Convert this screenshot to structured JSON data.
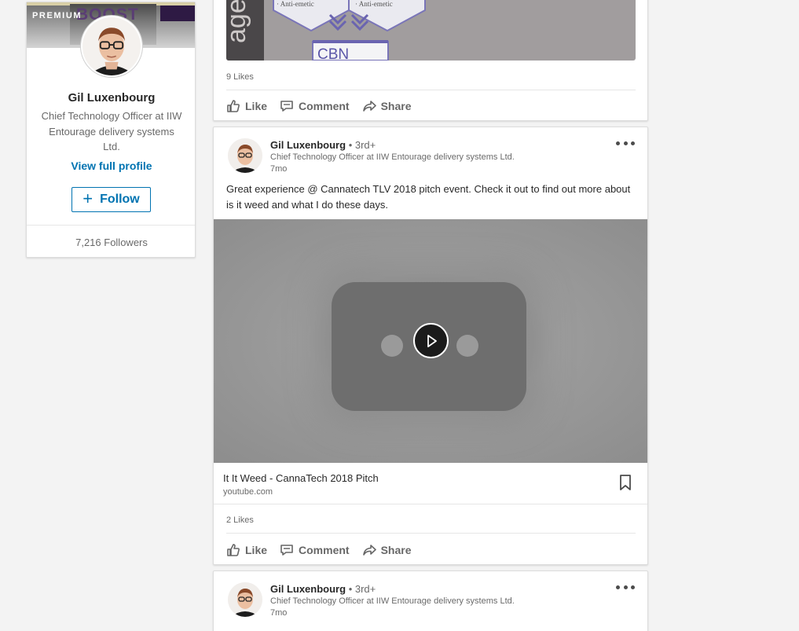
{
  "profile": {
    "badge": "PREMIUM",
    "cover_text": "BOOST",
    "name": "Gil Luxenbourg",
    "headline": "Chief Technology Officer at IIW Entourage delivery systems Ltd.",
    "view_profile_label": "View full profile",
    "follow_label": "Follow",
    "followers": "7,216 Followers"
  },
  "post1": {
    "image_labels": {
      "side_text": "aged",
      "tag_left": "· Anti-emetic",
      "tag_right": "· Anti-emetic",
      "box_label": "CBN"
    },
    "likes": "9 Likes",
    "actions": {
      "like": "Like",
      "comment": "Comment",
      "share": "Share"
    }
  },
  "post2": {
    "author": "Gil Luxenbourg",
    "degree": "• 3rd+",
    "headline": "Chief Technology Officer at IIW Entourage delivery systems Ltd.",
    "time": "7mo",
    "text": "Great experience @ Cannatech TLV 2018 pitch event. Check it out to find out more about is it weed and what I do these days.",
    "link_title": "It It Weed - CannaTech 2018 Pitch",
    "link_domain": "youtube.com",
    "likes": "2 Likes",
    "actions": {
      "like": "Like",
      "comment": "Comment",
      "share": "Share"
    }
  },
  "post3": {
    "author": "Gil Luxenbourg",
    "degree": "• 3rd+",
    "headline": "Chief Technology Officer at IIW Entourage delivery systems Ltd.",
    "time": "7mo"
  },
  "icons": {
    "like": "thumbs-up-icon",
    "comment": "comment-icon",
    "share": "share-arrow-icon",
    "more": "ellipsis-icon",
    "bookmark": "bookmark-icon",
    "play": "play-icon"
  },
  "colors": {
    "link_blue": "#0073b1",
    "background": "#f3f3f3"
  }
}
